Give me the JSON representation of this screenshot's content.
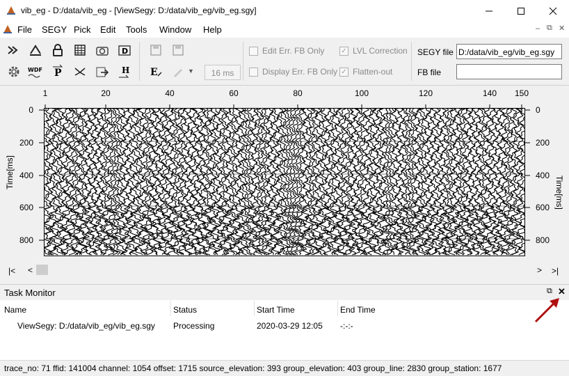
{
  "window": {
    "title": "vib_eg - D:/data/vib_eg - [ViewSegy: D:/data/vib_eg/vib_eg.sgy]",
    "minimize_icon": "minimize-icon",
    "maximize_icon": "maximize-icon",
    "close_icon": "close-icon"
  },
  "menu": {
    "items": [
      "File",
      "SEGY",
      "Pick",
      "Edit",
      "Tools",
      "Window",
      "Help"
    ]
  },
  "toolbar": {
    "row1_icons": [
      "fast-forward-icon",
      "shift-icon",
      "lock-icon",
      "table-icon",
      "camera-icon",
      "d-icon",
      "save-icon",
      "save-all-icon"
    ],
    "row2_icons": [
      "gear-icon",
      "wdf-icon",
      "p-icon",
      "pick-icon",
      "export-icon",
      "h-icon",
      "e-edit-icon",
      "pen-icon"
    ],
    "ms_value": "16 ms",
    "edit_err_fb_only": {
      "label": "Edit Err. FB Only",
      "checked": false
    },
    "display_err_fb_only": {
      "label": "Display Err. FB Only",
      "checked": false
    },
    "lvl_correction": {
      "label": "LVL Correction",
      "checked": true
    },
    "flatten_out": {
      "label": "Flatten-out",
      "checked": true
    },
    "segy_file_label": "SEGY file",
    "segy_file_value": "D:/data/vib_eg/vib_eg.sgy",
    "fb_file_label": "FB file",
    "fb_file_value": ""
  },
  "plot": {
    "x_ticks": [
      "1",
      "20",
      "40",
      "60",
      "80",
      "100",
      "120",
      "140",
      "150"
    ],
    "y_ticks": [
      "0",
      "200",
      "400",
      "600",
      "800"
    ],
    "y_label_left": "Time[ms]",
    "y_label_right": "Time[ms]"
  },
  "scrollbar": {
    "first": "|<",
    "prev": "<",
    "next": ">",
    "last": ">|"
  },
  "task_monitor": {
    "title": "Task Monitor",
    "columns": [
      "Name",
      "Status",
      "Start Time",
      "End Time"
    ],
    "rows": [
      {
        "name": "ViewSegy: D:/data/vib_eg/vib_eg.sgy",
        "status": "Processing",
        "start": "2020-03-29 12:05",
        "end": "-:-:-"
      }
    ],
    "restore_icon": "restore-icon",
    "close_icon": "close-icon",
    "arrow_color": "#b01010"
  },
  "status_bar": {
    "text": "trace_no: 71  ffid: 141004  channel: 1054  offset: 1715  source_elevation: 393  group_elevation: 403  group_line: 2830  group_station: 1677"
  }
}
